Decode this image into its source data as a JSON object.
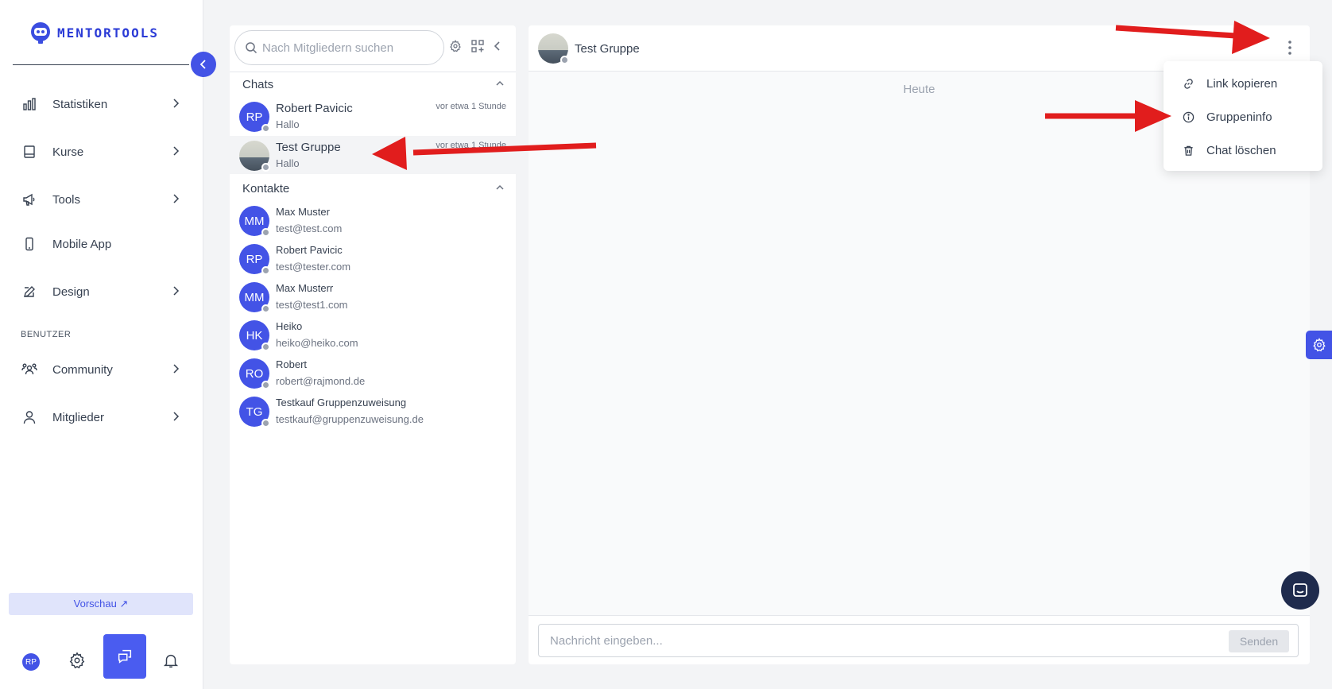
{
  "brand": {
    "name": "MENTORTOOLS",
    "color": "#4353e6"
  },
  "sidebar": {
    "items": [
      {
        "label": "Statistiken",
        "icon": "bar-chart-icon",
        "has_submenu": true
      },
      {
        "label": "Kurse",
        "icon": "book-icon",
        "has_submenu": true
      },
      {
        "label": "Tools",
        "icon": "megaphone-icon",
        "has_submenu": true
      },
      {
        "label": "Mobile App",
        "icon": "phone-icon",
        "has_submenu": false
      },
      {
        "label": "Design",
        "icon": "pencil-icon",
        "has_submenu": true
      }
    ],
    "section_label": "BENUTZER",
    "user_items": [
      {
        "label": "Community",
        "icon": "users-icon",
        "has_submenu": true
      },
      {
        "label": "Mitglieder",
        "icon": "user-icon",
        "has_submenu": true
      }
    ],
    "preview_label": "Vorschau ↗",
    "user_initials": "RP"
  },
  "chat_list": {
    "search_placeholder": "Nach Mitgliedern suchen",
    "chats_header": "Chats",
    "contacts_header": "Kontakte",
    "chats": [
      {
        "initials": "RP",
        "name": "Robert Pavicic",
        "preview": "Hallo",
        "time": "vor etwa 1 Stunde",
        "active": false
      },
      {
        "initials": "",
        "name": "Test Gruppe",
        "preview": "Hallo",
        "time": "vor etwa 1 Stunde",
        "active": true
      }
    ],
    "contacts": [
      {
        "initials": "MM",
        "name": "Max Muster",
        "email": "test@test.com"
      },
      {
        "initials": "RP",
        "name": "Robert Pavicic",
        "email": "test@tester.com"
      },
      {
        "initials": "MM",
        "name": "Max Musterr",
        "email": "test@test1.com"
      },
      {
        "initials": "HK",
        "name": "Heiko",
        "email": "heiko@heiko.com"
      },
      {
        "initials": "RO",
        "name": "Robert",
        "email": "robert@rajmond.de"
      },
      {
        "initials": "TG",
        "name": "Testkauf Gruppenzuweisung",
        "email": "testkauf@gruppenzuweisung.de"
      }
    ]
  },
  "conversation": {
    "title": "Test Gruppe",
    "date_separator": "Heute",
    "input_placeholder": "Nachricht eingeben...",
    "send_label": "Senden"
  },
  "menu": {
    "items": [
      {
        "label": "Link kopieren",
        "icon": "link-icon"
      },
      {
        "label": "Gruppeninfo",
        "icon": "info-icon"
      },
      {
        "label": "Chat löschen",
        "icon": "trash-icon"
      }
    ]
  },
  "annotation_color": "#e11d1d"
}
